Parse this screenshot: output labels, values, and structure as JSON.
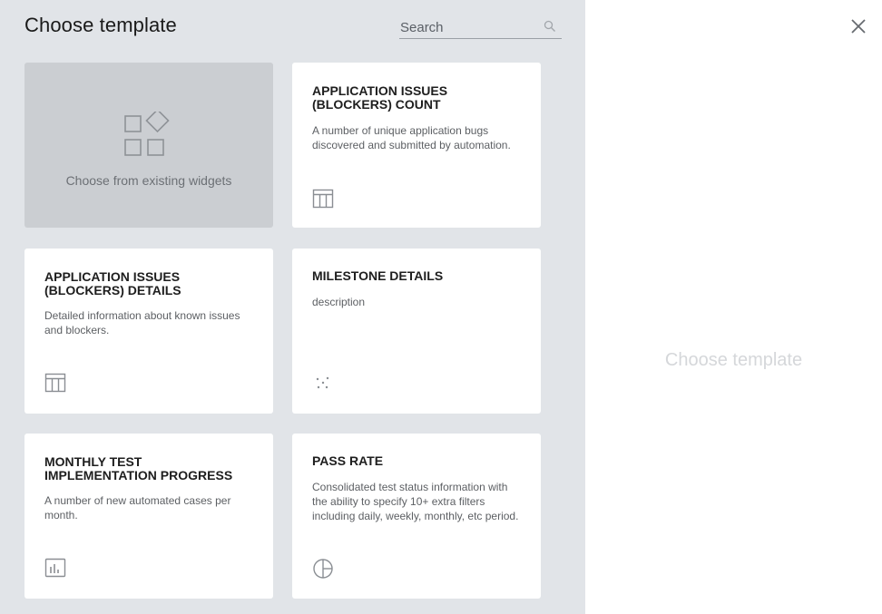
{
  "header": {
    "title": "Choose template",
    "search_placeholder": "Search"
  },
  "existing_widgets": {
    "label": "Choose from existing widgets",
    "icon": "widgets-grid-icon"
  },
  "templates": [
    {
      "title": "APPLICATION ISSUES (BLOCKERS) COUNT",
      "description": "A number of unique application bugs discovered and submitted by automation.",
      "icon": "table-icon"
    },
    {
      "title": "APPLICATION ISSUES (BLOCKERS) DETAILS",
      "description": "Detailed information about known issues and blockers.",
      "icon": "table-icon"
    },
    {
      "title": "MILESTONE DETAILS",
      "description": "description",
      "icon": "scatter-icon"
    },
    {
      "title": "MONTHLY TEST IMPLEMENTATION PROGRESS",
      "description": "A number of new automated cases per month.",
      "icon": "bar-chart-icon"
    },
    {
      "title": "PASS RATE",
      "description": "Consolidated test status information with the ability to specify 10+ extra filters including daily, weekly, monthly, etc period.",
      "icon": "pie-chart-icon"
    }
  ],
  "preview": {
    "placeholder": "Choose template"
  },
  "colors": {
    "panel_bg": "#e1e4e8",
    "card_bg": "#ffffff",
    "existing_card_bg": "#cbced2",
    "icon_gray": "#8a8e93"
  }
}
